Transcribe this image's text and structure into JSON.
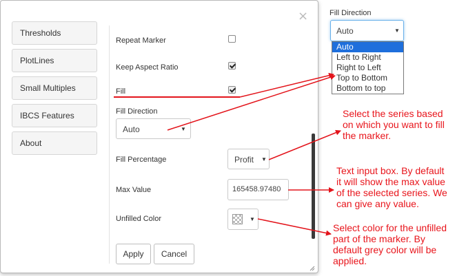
{
  "dialog": {
    "close_icon": "×",
    "nav": [
      {
        "label": "Thresholds"
      },
      {
        "label": "PlotLines"
      },
      {
        "label": "Small Multiples"
      },
      {
        "label": "IBCS Features"
      },
      {
        "label": "About"
      }
    ],
    "repeat_marker": {
      "label": "Repeat Marker",
      "checked": false
    },
    "keep_aspect_ratio": {
      "label": "Keep Aspect Ratio",
      "checked": true
    },
    "fill": {
      "label": "Fill",
      "checked": true
    },
    "fill_direction": {
      "label": "Fill Direction",
      "value": "Auto"
    },
    "fill_percentage": {
      "label": "Fill Percentage",
      "value": "Profit"
    },
    "max_value": {
      "label": "Max Value",
      "value": "165458.97480"
    },
    "unfilled_color": {
      "label": "Unfilled Color",
      "icon": "checkerboard-swatch-icon"
    },
    "apply_label": "Apply",
    "cancel_label": "Cancel"
  },
  "dropdown": {
    "title": "Fill Direction",
    "selected": "Auto",
    "options": [
      "Auto",
      "Left to Right",
      "Right to Left",
      "Top to Bottom",
      "Bottom to top"
    ]
  },
  "annotations": {
    "fill_percentage_note": [
      "Select the series based",
      "on which you want to fill",
      "the marker."
    ],
    "max_value_note": [
      "Text input box. By default",
      "it will show the max value",
      "of the selected series. We",
      "can give any value."
    ],
    "unfilled_color_note": [
      "Select color for the unfilled",
      "part of the marker. By",
      "default grey color will be",
      "applied."
    ]
  },
  "colors": {
    "annotation": "#e8141b",
    "dropdown_highlight": "#1e6fdc",
    "focus_border": "#66afe9"
  }
}
